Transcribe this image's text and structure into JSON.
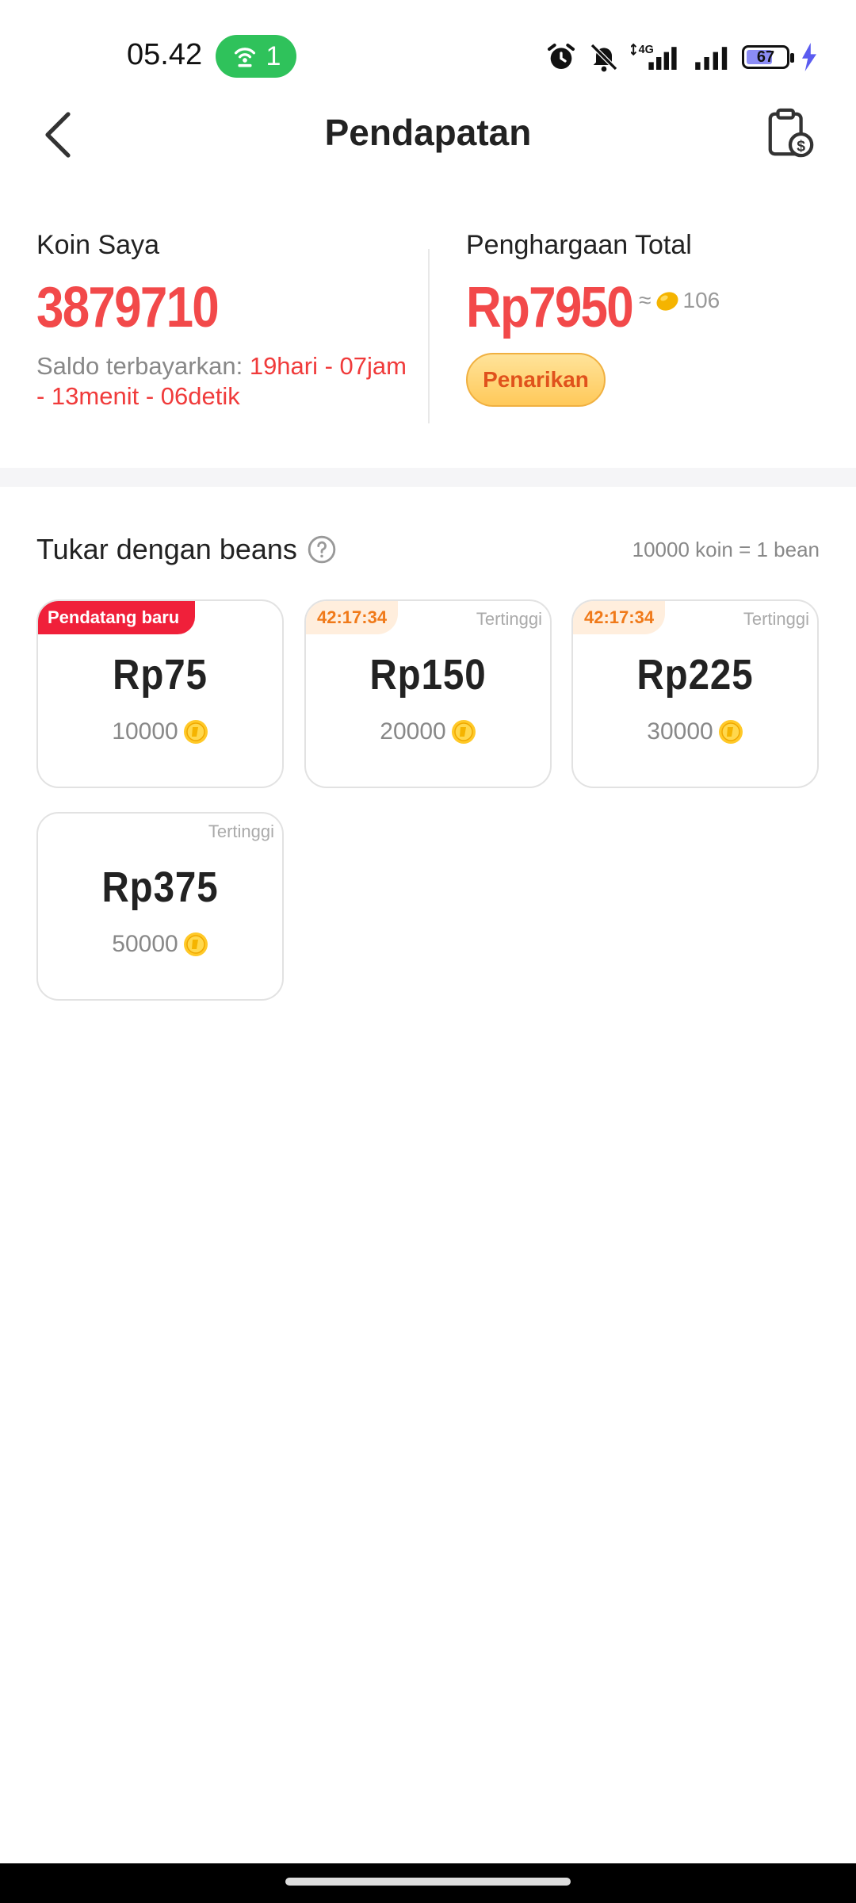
{
  "status_bar": {
    "time": "05.42",
    "hotspot_count": "1",
    "network": "4G",
    "battery_level": "67",
    "battery_fraction": 0.67
  },
  "header": {
    "title": "Pendapatan"
  },
  "summary": {
    "coins_label": "Koin Saya",
    "coins_value": "3879710",
    "saldo_label": "Saldo terbayarkan: ",
    "saldo_countdown": "19hari - 07jam - 13menit - 06detik",
    "reward_label": "Penghargaan Total",
    "reward_value": "Rp7950",
    "reward_approx_symbol": "≈",
    "reward_beans": "106",
    "withdraw_label": "Penarikan"
  },
  "exchange": {
    "title": "Tukar dengan beans",
    "rate": "10000 koin = 1 bean",
    "cards": [
      {
        "badge": "Pendatang baru",
        "badge_type": "new",
        "top_label": "",
        "price": "Rp75",
        "cost": "10000"
      },
      {
        "badge": "42:17:34",
        "badge_type": "timer",
        "top_label": "Tertinggi",
        "price": "Rp150",
        "cost": "20000"
      },
      {
        "badge": "42:17:34",
        "badge_type": "timer",
        "top_label": "Tertinggi",
        "price": "Rp225",
        "cost": "30000"
      },
      {
        "badge": "",
        "badge_type": "none",
        "top_label": "Tertinggi",
        "price": "Rp375",
        "cost": "50000"
      }
    ]
  },
  "colors": {
    "accent_red": "#f2494a",
    "countdown_red": "#f03b3b",
    "withdraw_text": "#e0521c",
    "new_badge": "#f0203a",
    "timer_text": "#f07a1a"
  },
  "icons": {
    "back": "chevron-left-icon",
    "history": "clipboard-dollar-icon",
    "help": "question-circle-icon",
    "coin": "coin-icon",
    "bean": "bean-icon"
  }
}
